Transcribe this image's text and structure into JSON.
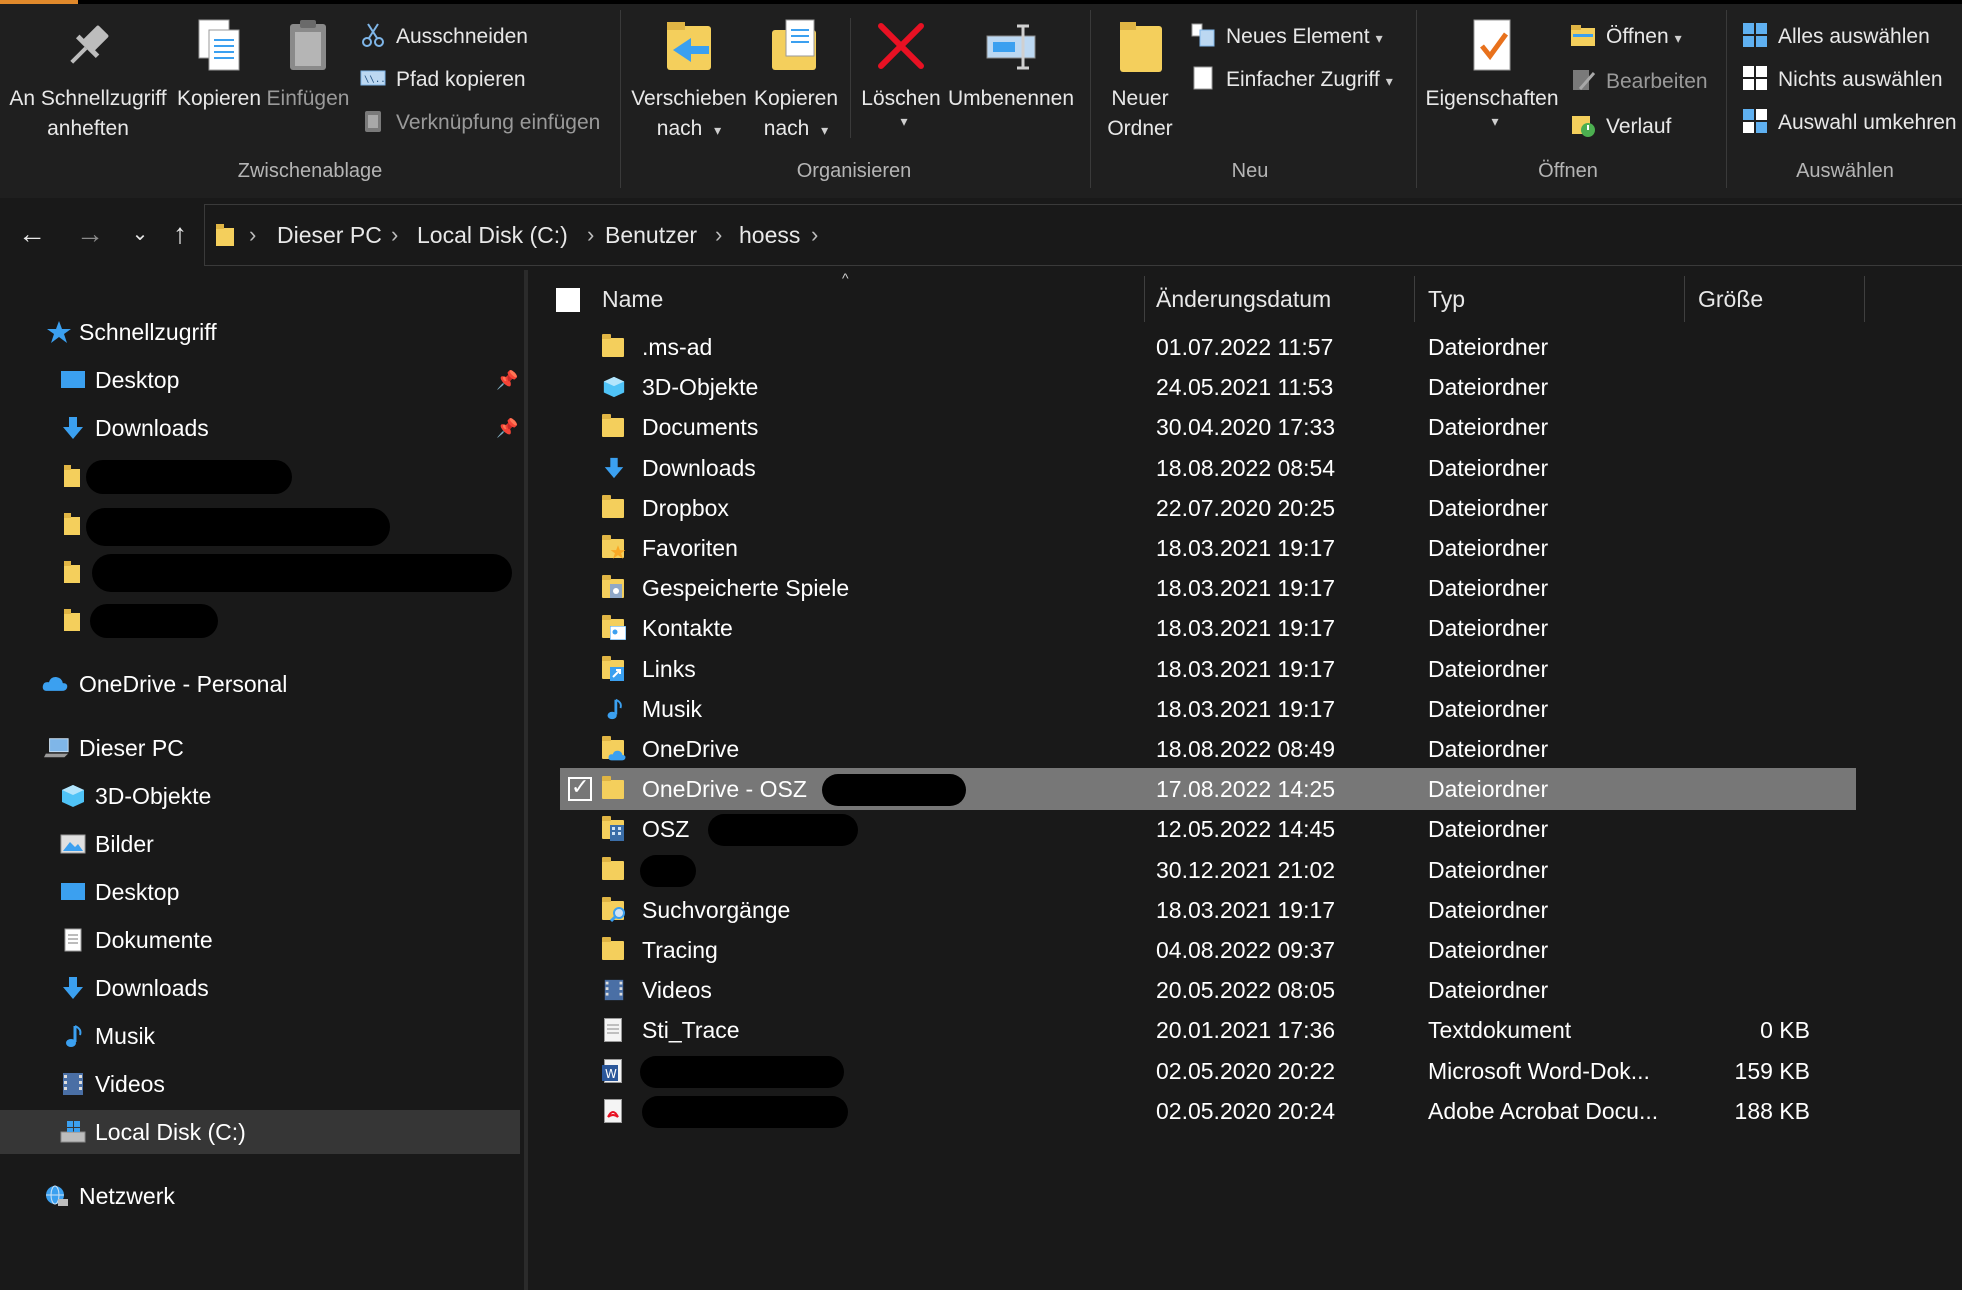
{
  "ribbon": {
    "clipboard": {
      "pin_label": "An Schnellzugriff anheften",
      "copy_label": "Kopieren",
      "paste_label": "Einfügen",
      "cut_label": "Ausschneiden",
      "copy_path_label": "Pfad kopieren",
      "paste_shortcut_label": "Verknüpfung einfügen",
      "group_label": "Zwischenablage"
    },
    "organize": {
      "move_to_label": "Verschieben nach",
      "copy_to_label": "Kopieren nach",
      "delete_label": "Löschen",
      "rename_label": "Umbenennen",
      "group_label": "Organisieren"
    },
    "new": {
      "new_folder_label": "Neuer Ordner",
      "new_item_label": "Neues Element",
      "easy_access_label": "Einfacher Zugriff",
      "group_label": "Neu"
    },
    "open": {
      "properties_label": "Eigenschaften",
      "open_label": "Öffnen",
      "edit_label": "Bearbeiten",
      "history_label": "Verlauf",
      "group_label": "Öffnen"
    },
    "select": {
      "select_all_label": "Alles auswählen",
      "select_none_label": "Nichts auswählen",
      "invert_label": "Auswahl umkehren",
      "group_label": "Auswählen"
    }
  },
  "address": {
    "crumbs": [
      "Dieser PC",
      "Local Disk (C:)",
      "Benutzer",
      "hoess"
    ]
  },
  "sidebar": {
    "quick_access": "Schnellzugriff",
    "quick_items": [
      "Desktop",
      "Downloads"
    ],
    "onedrive": "OneDrive - Personal",
    "this_pc": "Dieser PC",
    "pc_items": [
      "3D-Objekte",
      "Bilder",
      "Desktop",
      "Dokumente",
      "Downloads",
      "Musik",
      "Videos",
      "Local Disk (C:)"
    ],
    "network": "Netzwerk"
  },
  "columns": {
    "name": "Name",
    "date": "Änderungsdatum",
    "type": "Typ",
    "size": "Größe"
  },
  "files": [
    {
      "name": ".ms-ad",
      "date": "01.07.2022 11:57",
      "type": "Dateiordner",
      "size": "",
      "icon": "folder-icon"
    },
    {
      "name": "3D-Objekte",
      "date": "24.05.2021 11:53",
      "type": "Dateiordner",
      "size": "",
      "icon": "3d-objects-icon"
    },
    {
      "name": "Documents",
      "date": "30.04.2020 17:33",
      "type": "Dateiordner",
      "size": "",
      "icon": "folder-icon"
    },
    {
      "name": "Downloads",
      "date": "18.08.2022 08:54",
      "type": "Dateiordner",
      "size": "",
      "icon": "download-arrow-icon"
    },
    {
      "name": "Dropbox",
      "date": "22.07.2020 20:25",
      "type": "Dateiordner",
      "size": "",
      "icon": "folder-icon"
    },
    {
      "name": "Favoriten",
      "date": "18.03.2021 19:17",
      "type": "Dateiordner",
      "size": "",
      "icon": "favorites-folder-icon"
    },
    {
      "name": "Gespeicherte Spiele",
      "date": "18.03.2021 19:17",
      "type": "Dateiordner",
      "size": "",
      "icon": "saved-games-folder-icon"
    },
    {
      "name": "Kontakte",
      "date": "18.03.2021 19:17",
      "type": "Dateiordner",
      "size": "",
      "icon": "contacts-folder-icon"
    },
    {
      "name": "Links",
      "date": "18.03.2021 19:17",
      "type": "Dateiordner",
      "size": "",
      "icon": "links-folder-icon"
    },
    {
      "name": "Musik",
      "date": "18.03.2021 19:17",
      "type": "Dateiordner",
      "size": "",
      "icon": "music-note-icon"
    },
    {
      "name": "OneDrive",
      "date": "18.08.2022 08:49",
      "type": "Dateiordner",
      "size": "",
      "icon": "onedrive-folder-icon"
    },
    {
      "name": "OneDrive - OSZ",
      "date": "17.08.2022 14:25",
      "type": "Dateiordner",
      "size": "",
      "icon": "folder-icon",
      "selected": true,
      "redacted": true
    },
    {
      "name": "OSZ",
      "date": "12.05.2022 14:45",
      "type": "Dateiordner",
      "size": "",
      "icon": "building-folder-icon",
      "redacted": true
    },
    {
      "name": "",
      "date": "30.12.2021 21:02",
      "type": "Dateiordner",
      "size": "",
      "icon": "folder-icon",
      "redacted": true
    },
    {
      "name": "Suchvorgänge",
      "date": "18.03.2021 19:17",
      "type": "Dateiordner",
      "size": "",
      "icon": "search-folder-icon"
    },
    {
      "name": "Tracing",
      "date": "04.08.2022 09:37",
      "type": "Dateiordner",
      "size": "",
      "icon": "folder-icon"
    },
    {
      "name": "Videos",
      "date": "20.05.2022 08:05",
      "type": "Dateiordner",
      "size": "",
      "icon": "video-film-icon"
    },
    {
      "name": "Sti_Trace",
      "date": "20.01.2021 17:36",
      "type": "Textdokument",
      "size": "0 KB",
      "icon": "text-document-icon"
    },
    {
      "name": "",
      "date": "02.05.2020 20:22",
      "type": "Microsoft Word-Dok...",
      "size": "159 KB",
      "icon": "word-document-icon",
      "redacted": true
    },
    {
      "name": "",
      "date": "02.05.2020 20:24",
      "type": "Adobe Acrobat Docu...",
      "size": "188 KB",
      "icon": "pdf-document-icon",
      "redacted": true
    }
  ],
  "colors": {
    "background": "#191919",
    "ribbon": "#1f1f1f",
    "selected_row": "#777777",
    "folder": "#f4cf5c",
    "accent_blue": "#3ba0f0",
    "delete_red": "#e81123"
  }
}
